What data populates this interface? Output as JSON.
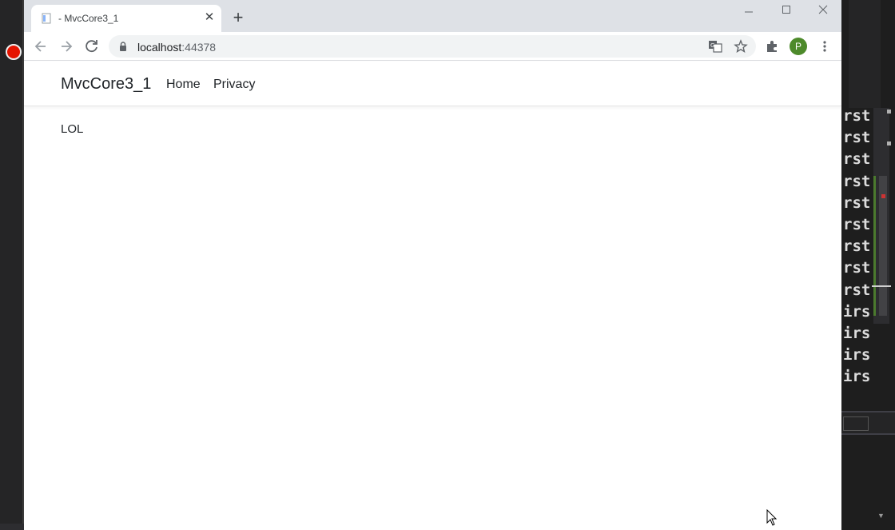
{
  "browser": {
    "tab_title": "- MvcCore3_1",
    "url_host": "localhost",
    "url_port": ":44378",
    "profile_initial": "P"
  },
  "site": {
    "brand": "MvcCore3_1",
    "nav": [
      {
        "label": "Home"
      },
      {
        "label": "Privacy"
      }
    ],
    "content": "LOL"
  },
  "ide": {
    "code_lines": [
      "rst",
      "rst",
      "rst",
      "rst",
      "rst",
      "rst",
      "rst",
      "rst",
      "rst",
      "irs",
      "irs",
      "irs",
      "irs"
    ]
  },
  "colors": {
    "tabbar": "#dee1e6",
    "profile": "#4d8a2b",
    "breakpoint": "#e51400"
  }
}
